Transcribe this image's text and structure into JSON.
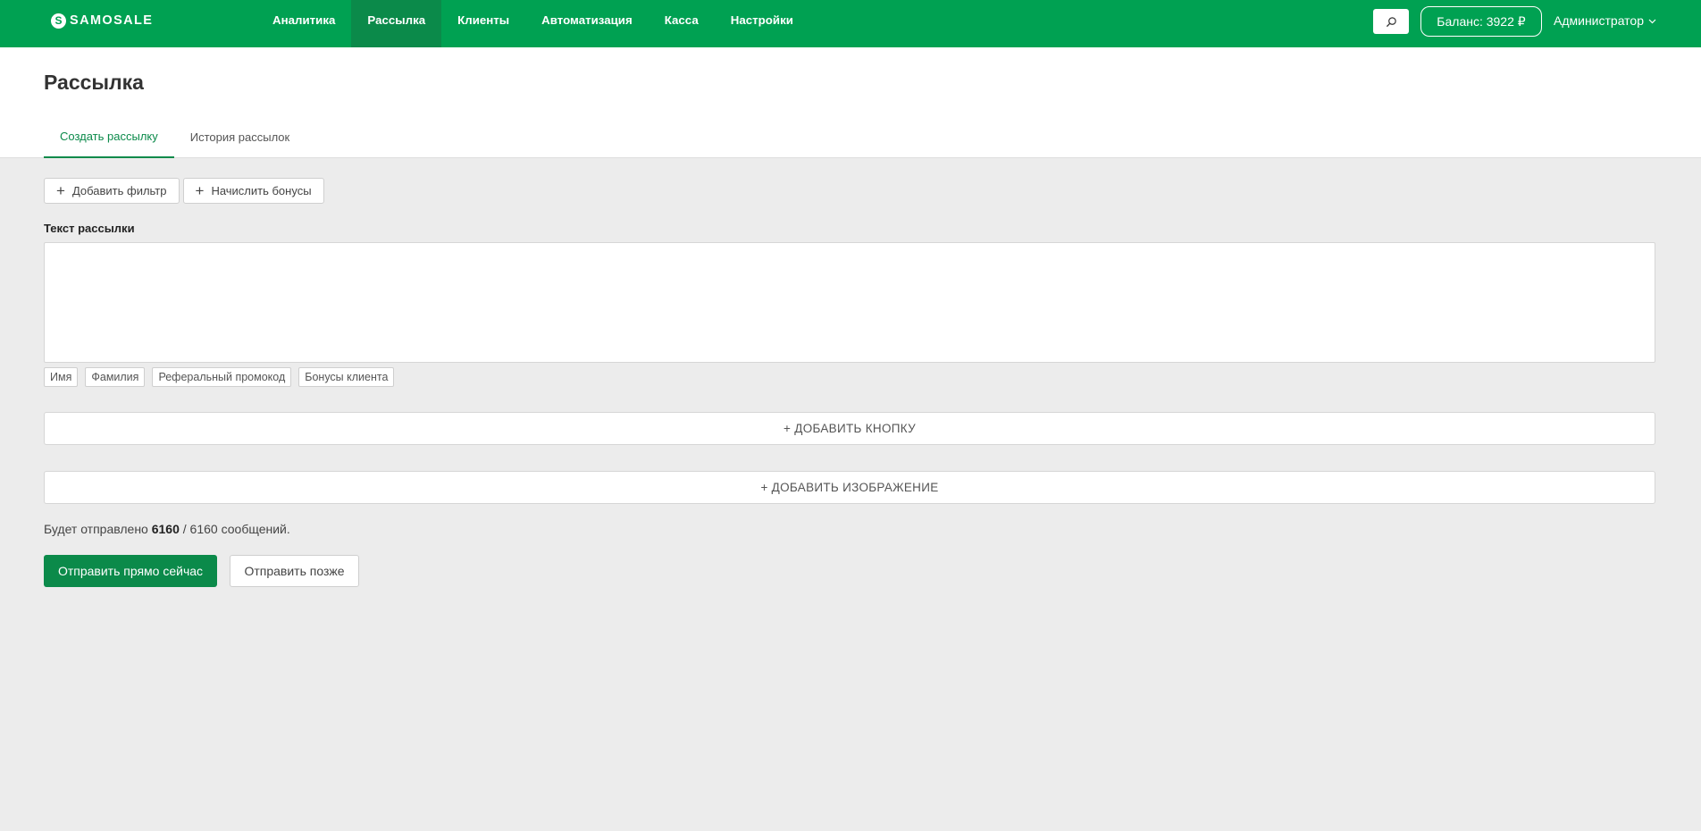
{
  "brand": {
    "logo_mark": "S",
    "name": "SAMOSALE"
  },
  "nav": {
    "items": [
      {
        "label": "Аналитика"
      },
      {
        "label": "Рассылка",
        "active": true
      },
      {
        "label": "Клиенты"
      },
      {
        "label": "Автоматизация"
      },
      {
        "label": "Касса"
      },
      {
        "label": "Настройки"
      }
    ],
    "search_icon": "search-icon",
    "balance_label": "Баланс: 3922 ₽",
    "user_label": "Администратор",
    "user_chevron": "chevron-down-icon"
  },
  "page": {
    "title": "Рассылка",
    "tabs": [
      {
        "label": "Создать рассылку",
        "active": true
      },
      {
        "label": "История рассылок"
      }
    ]
  },
  "form": {
    "add_filter_label": "Добавить фильтр",
    "add_bonus_label": "Начислить бонусы",
    "text_label": "Текст рассылки",
    "text_value": "",
    "variables": [
      "Имя",
      "Фамилия",
      "Реферальный промокод",
      "Бонусы клиента"
    ],
    "add_button_label": "+ ДОБАВИТЬ КНОПКУ",
    "add_image_label": "+ ДОБАВИТЬ ИЗОБРАЖЕНИЕ",
    "summary": {
      "prefix": "Будет отправлено",
      "count": "6160",
      "suffix": "/ 6160 сообщений."
    },
    "send_now_label": "Отправить прямо сейчас",
    "send_later_label": "Отправить позже"
  },
  "colors": {
    "brand_green": "#00a152",
    "accent_green": "#0b8a4a",
    "background": "#ececec"
  }
}
